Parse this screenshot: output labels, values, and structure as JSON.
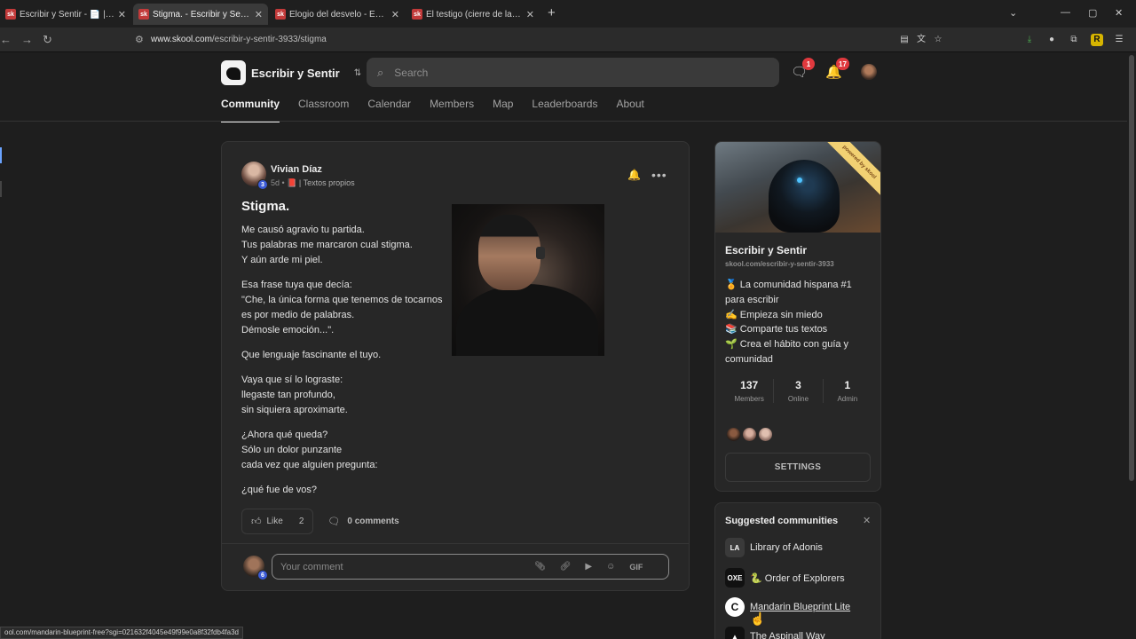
{
  "browser": {
    "tabs": [
      {
        "title": "Escribir y Sentir - 📄 | Textos pr",
        "active": false
      },
      {
        "title": "Stigma. - Escribir y Sentir",
        "active": true
      },
      {
        "title": "Elogio del desvelo - Escribir y Se",
        "active": false
      },
      {
        "title": "El testigo (cierre de la saga de ⌐",
        "active": false
      }
    ],
    "favicon_label": "sk",
    "url_domain": "www.skool.com",
    "url_path": "/escribir-y-sentir-3933/stigma",
    "status_url": "ool.com/mandarin-blueprint-free?sgi=021632f4045e49f99e0a8f32fdb4fa3d"
  },
  "header": {
    "group_name": "Escribir y Sentir",
    "search_placeholder": "Search",
    "chat_badge": "1",
    "notif_badge": "17"
  },
  "nav": {
    "tabs": [
      "Community",
      "Classroom",
      "Calendar",
      "Members",
      "Map",
      "Leaderboards",
      "About"
    ],
    "active": "Community"
  },
  "post": {
    "author": "Vivian Díaz",
    "level": "3",
    "time": "5d •",
    "category": "📕 | Textos propios",
    "title": "Stigma.",
    "stanzas": [
      "Me causó agravio tu partida.\nTus palabras me marcaron cual stigma.\nY aún arde mi piel.",
      "Esa frase tuya que decía:\n\"Che, la única forma que tenemos de tocarnos es por medio de palabras.\nDémosle emoción...\".",
      "Que lenguaje fascinante el tuyo.",
      "Vaya que sí lo lograste:\nllegaste tan profundo,\nsin siquiera aproximarte.",
      "¿Ahora qué queda?\nSólo un dolor punzante\ncada vez que alguien pregunta:",
      "¿qué fue de vos?"
    ],
    "like_label": "Like",
    "like_count": "2",
    "comments_label": "0 comments",
    "comment_placeholder": "Your comment",
    "gif_label": "GIF",
    "my_level": "6"
  },
  "sidebar": {
    "ribbon_text": "powered by skool",
    "group_name": "Escribir y Sentir",
    "group_url": "skool.com/escribir-y-sentir-3933",
    "description_lines": [
      "🏅 La comunidad hispana #1 para escribir",
      "✍️ Empieza sin miedo",
      "📚 Comparte tus textos",
      "🌱 Crea el hábito con guía y comunidad"
    ],
    "stats": [
      {
        "value": "137",
        "label": "Members"
      },
      {
        "value": "3",
        "label": "Online"
      },
      {
        "value": "1",
        "label": "Admin"
      }
    ],
    "settings_label": "SETTINGS"
  },
  "suggested": {
    "title": "Suggested communities",
    "items": [
      {
        "name": "Library of Adonis",
        "icon_label": "LA",
        "color": "#3a3a3a"
      },
      {
        "name": "🐍 Order of Explorers",
        "icon_label": "OXE",
        "color": "#111111"
      },
      {
        "name": "Mandarin Blueprint Lite",
        "icon_label": "C",
        "color": "#ffffff"
      },
      {
        "name": "The Aspinall Way",
        "icon_label": "▲",
        "color": "#111111"
      }
    ]
  },
  "colors": {
    "accent_badge": "#e0393e",
    "level_badge": "#3b5bd6",
    "background": "#1e1e1e",
    "card": "#272727"
  }
}
